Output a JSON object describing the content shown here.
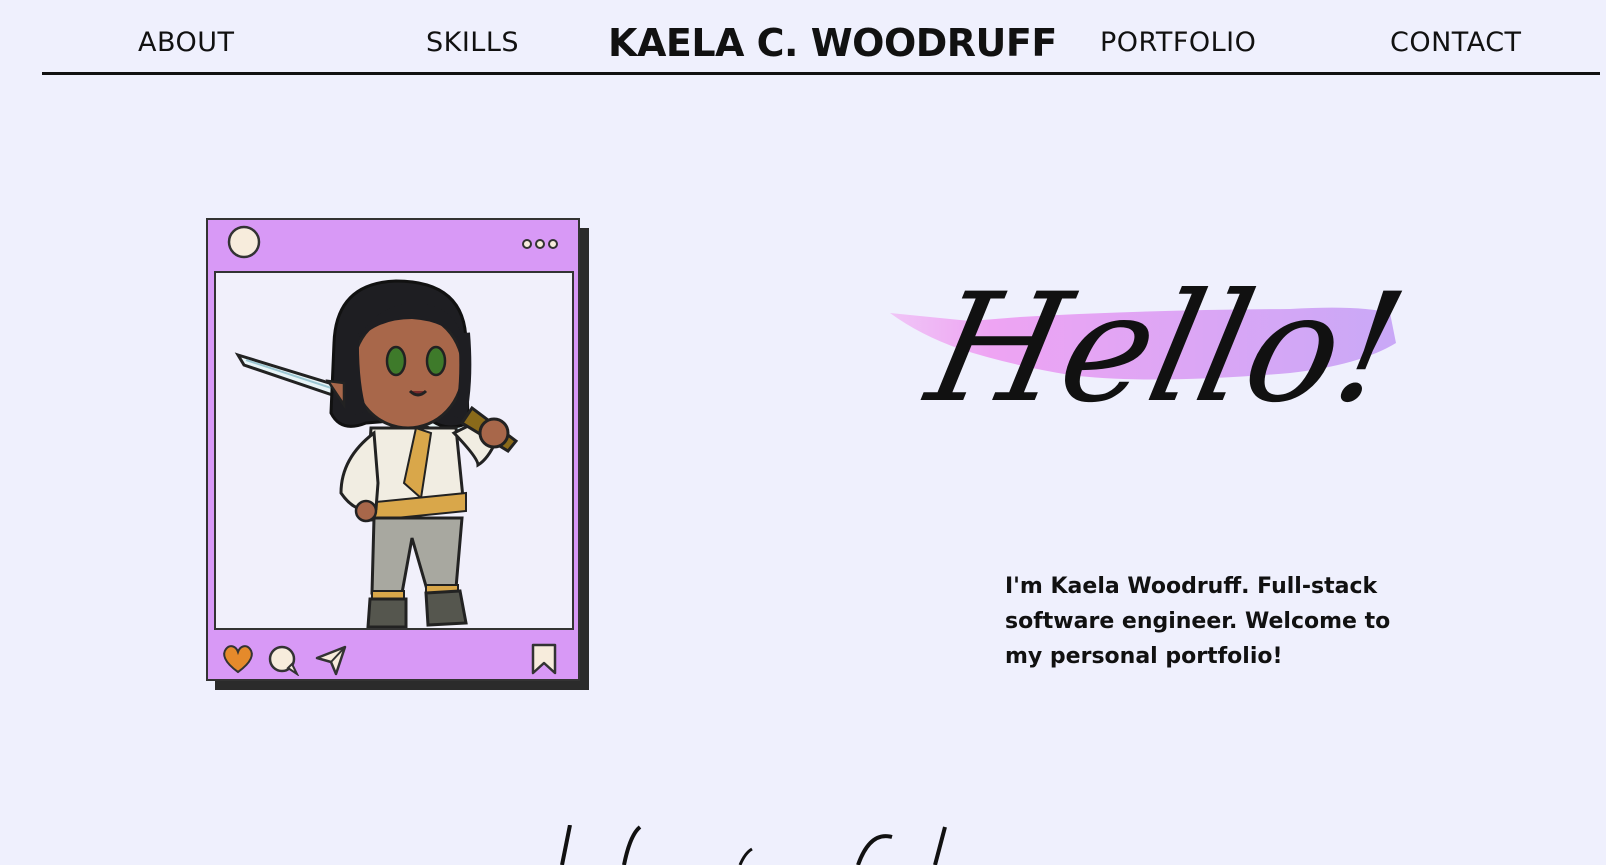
{
  "nav": {
    "about": "ABOUT",
    "skills": "SKILLS",
    "brand": "KAELA C. WOODRUFF",
    "portfolio": "PORTFOLIO",
    "contact": "CONTACT"
  },
  "hero": {
    "greeting": "Hello!",
    "intro": "I'm Kaela Woodruff. Full-stack software engineer. Welcome to my personal portfolio!"
  },
  "post_card": {
    "icons": [
      "avatar-circle-icon",
      "more-dots-icon",
      "heart-icon",
      "comment-icon",
      "send-icon",
      "bookmark-icon"
    ],
    "frame_color": "#d899f6",
    "heart_color": "#e58a2b"
  },
  "colors": {
    "background": "#eff0fd",
    "brush_start": "#f0a8f2",
    "brush_end": "#c9a8f7"
  }
}
